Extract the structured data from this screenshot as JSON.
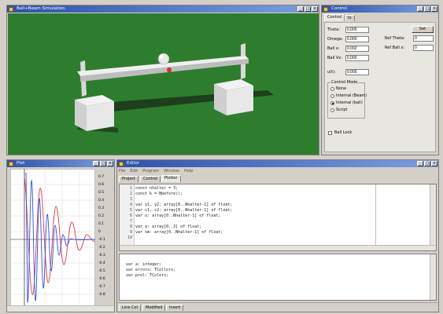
{
  "sim_window": {
    "title": "Ball+Beam Simulation"
  },
  "control_window": {
    "title": "Control",
    "tabs": [
      "Control",
      "Io"
    ],
    "fields": [
      {
        "label": "Theta:",
        "value": "0.000"
      },
      {
        "label": "Omega:",
        "value": "0.000"
      },
      {
        "label": "Ball x:",
        "value": "0.002"
      },
      {
        "label": "Ball Vx:",
        "value": "0.000"
      },
      {
        "label": "u(t):",
        "value": "0.000"
      }
    ],
    "set_button": "Set",
    "ref_fields": [
      {
        "label": "Ref Theta:",
        "value": "0"
      },
      {
        "label": "Ref Ball x:",
        "value": "0"
      }
    ],
    "control_mode": {
      "title": "Control Mode",
      "options": [
        "None",
        "Internal (Beam)",
        "Internal (ball)",
        "Script"
      ],
      "selected": 2
    },
    "ball_lock_label": "Ball Lock"
  },
  "plot_window": {
    "title": "Plot",
    "y_ticks": [
      "0.7",
      "0.6",
      "0.5",
      "0.4",
      "0.3",
      "0.2",
      "0.1",
      "0",
      "-0.1",
      "-0.2",
      "-0.3",
      "-0.4",
      "-0.5",
      "-0.6",
      "-0.7",
      "-0.8"
    ]
  },
  "editor_window": {
    "title": "Editor",
    "menu": [
      "File",
      "Edit",
      "Program",
      "Window",
      "Help"
    ],
    "tabs": [
      "Project",
      "Control",
      "Plotter"
    ],
    "code_lines": [
      "const nhalter = 3;",
      "const k = Nbefore();",
      "",
      "var y1, y2: array[0..Nhalter-1] of float;",
      "var c1, c2: array[0..Nhalter-1] of float;",
      "var u: array[0..Nhalter-1] of float;",
      "",
      "var a: array[0..3] of float;",
      "var sm: array[0..Nhalter-1] of float;",
      ""
    ],
    "line_numbers": [
      "1",
      "2",
      "3",
      "4",
      "5",
      "6",
      "7",
      "8",
      "9",
      "10"
    ],
    "output_lines": [
      "var a: integer;",
      "var errors: TCollors;",
      "var prol: TColors;"
    ],
    "status_tabs": [
      "Line Col",
      "Modified",
      "Insert"
    ]
  },
  "colors": {
    "floor": "#2e7d2e",
    "plot_blue": "#3050e0",
    "plot_red": "#e04040",
    "title_blue": "#2d52a8"
  }
}
